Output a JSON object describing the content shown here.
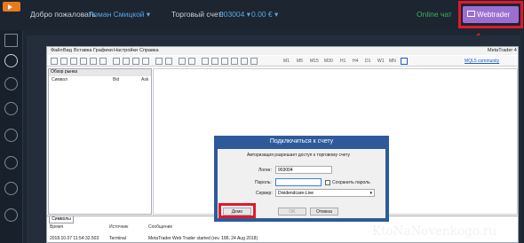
{
  "topbar": {
    "welcome": "Добро пожаловать",
    "user_name": "Роман Смицкой",
    "account_label": "Торговый счет:",
    "account_number": "903004",
    "balance": "0.00 €",
    "online_chat": "Online чат",
    "webtrader_label": "Webtrader"
  },
  "mt4": {
    "window_title": "MetaTrader 4",
    "menu": [
      "Файл",
      "Вид",
      "Вставка",
      "Графики",
      "Настройки",
      "Справка"
    ],
    "timeframes": [
      "M1",
      "M5",
      "M15",
      "M30",
      "H1",
      "H4",
      "D1",
      "W1",
      "MN"
    ],
    "mql5_link": "MQL5 community",
    "market_watch": {
      "title": "Обзор рынка",
      "columns": [
        "Символ",
        "Bid",
        "Ask"
      ]
    },
    "tab_symbols": "Символы",
    "journal": {
      "columns": [
        "Время",
        "Источник",
        "Сообщение"
      ],
      "row": {
        "time": "2018.10.07 11:54:32.503",
        "source": "Terminal",
        "message": "MetaTrader Web Trader started (rev. 186, 24 Aug 2018)"
      }
    }
  },
  "dialog": {
    "title": "Подключиться к счету",
    "subtitle": "Авторизация разрешает доступ к торговому счету",
    "login_label": "Логин:",
    "login_value": "903004",
    "password_label": "Пароль:",
    "password_value": "",
    "save_password_label": "Сохранить пароль",
    "server_label": "Сервер:",
    "server_value": "Dividendcare-Live",
    "demo_button": "Демо",
    "ok_button": "OK",
    "cancel_button": "Отмена"
  },
  "watermark": "KtoNaNovenkogo.ru",
  "colors": {
    "accent_red": "#e0192b",
    "webtrader_purple": "#9b6fd1",
    "dialog_blue": "#2e5a9c"
  }
}
